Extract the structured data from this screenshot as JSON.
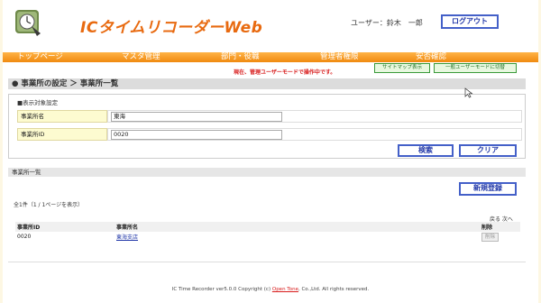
{
  "app": {
    "title": "ICタイムリコーダーWeb",
    "user_label": "ユーザー：鈴木　一郎",
    "logout": "ログアウト"
  },
  "nav": {
    "items": [
      "トップページ",
      "マスタ管理",
      "部門・役職",
      "管理者権限",
      "安否確認"
    ]
  },
  "mode": {
    "message": "現在、管理ユーザーモードで操作中です。",
    "sitemap_button": "サイトマップ表示",
    "switch_button": "一般ユーザーモードに切替"
  },
  "breadcrumb": "● 事業所の設定 ＞ 事業所一覧",
  "filter": {
    "title": "■表示対象設定",
    "name_label": "事業所名",
    "name_value": "東海",
    "id_label": "事業所ID",
    "id_value": "0020",
    "search": "検索",
    "clear": "クリア"
  },
  "list": {
    "title": "事業所一覧",
    "new_button": "新規登録",
    "count": "全1件（1 / 1ページを表示）",
    "pager": "戻る 次へ",
    "columns": [
      "事業所ID",
      "事業所名",
      "削除"
    ],
    "rows": [
      {
        "id": "0020",
        "name": "東海支店",
        "delete": "削除"
      }
    ]
  },
  "footer": {
    "prefix": "IC Time Recorder ver5.0.0 Copyright (c) ",
    "company": "Open Tone",
    "suffix": ", Co.,Ltd. All rights reserved."
  },
  "colors": {
    "accent": "#e86a10",
    "nav": "#f08a10",
    "button_border": "#4460c8",
    "warning": "#d81c1c"
  }
}
